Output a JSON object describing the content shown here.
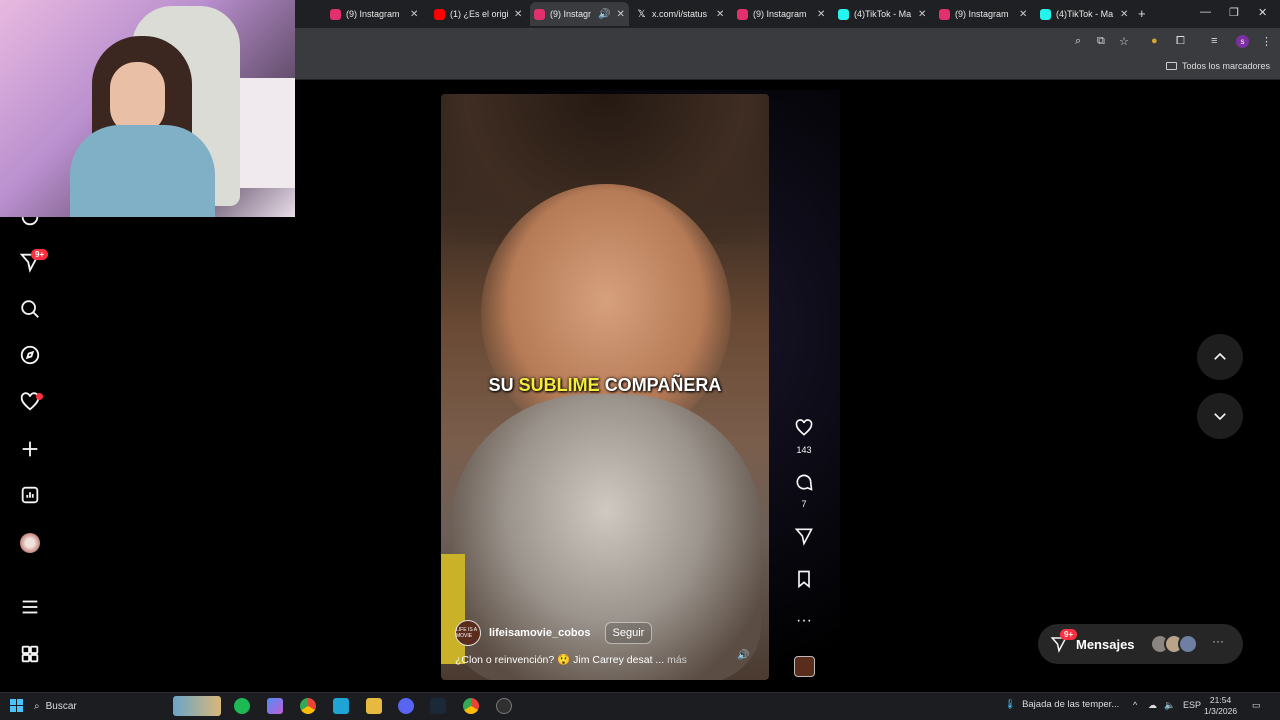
{
  "browser": {
    "tabs": [
      {
        "title": "(9) Instagram",
        "favicon_color": "#e1306c",
        "active": false
      },
      {
        "title": "(1) ¿Es el origi",
        "favicon_color": "#ff0000",
        "active": false
      },
      {
        "title": "(9) Instagr",
        "favicon_color": "#e1306c",
        "active": true
      },
      {
        "title": "x.com/i/status",
        "favicon_color": "#ffffff",
        "active": false
      },
      {
        "title": "(9) Instagram",
        "favicon_color": "#e1306c",
        "active": false
      },
      {
        "title": "(4)TikTok - Ma",
        "favicon_color": "#25f4ee",
        "active": false
      },
      {
        "title": "(9) Instagram",
        "favicon_color": "#e1306c",
        "active": false
      },
      {
        "title": "(4)TikTok - Ma",
        "favicon_color": "#25f4ee",
        "active": false
      }
    ],
    "bookmarks_all_label": "Todos los marcadores",
    "profile_initial": "s"
  },
  "sidebar": {
    "notifications_badge": "9+",
    "items": [
      "home-icon",
      "messenger-icon",
      "search-icon",
      "explore-icon",
      "heart-icon",
      "create-icon",
      "stats-icon",
      "profile-avatar",
      "menu-icon",
      "more-apps-icon"
    ]
  },
  "reel": {
    "caption_overlay": {
      "word1": "SU",
      "word2": "SUBLIME",
      "word3": "COMPAÑERA"
    },
    "username": "lifeisamovie_cobos",
    "avatar_text": "LIFE IS A MOVIE",
    "follow_label": "Seguir",
    "description": "¿Clon o reinvención? 😲 Jim Carrey desat ...",
    "more_label": "más",
    "likes": "143",
    "comments": "7"
  },
  "messages": {
    "label": "Mensajes",
    "badge": "9+"
  },
  "taskbar": {
    "search_label": "Buscar",
    "weather_text": "Bajada de las temper...",
    "language": "ESP",
    "time": "21:54",
    "date": "1/3/2026"
  },
  "colors": {
    "accent_badge": "#ff3040",
    "highlight_caption": "#f4ee3a",
    "background": "#000000"
  }
}
